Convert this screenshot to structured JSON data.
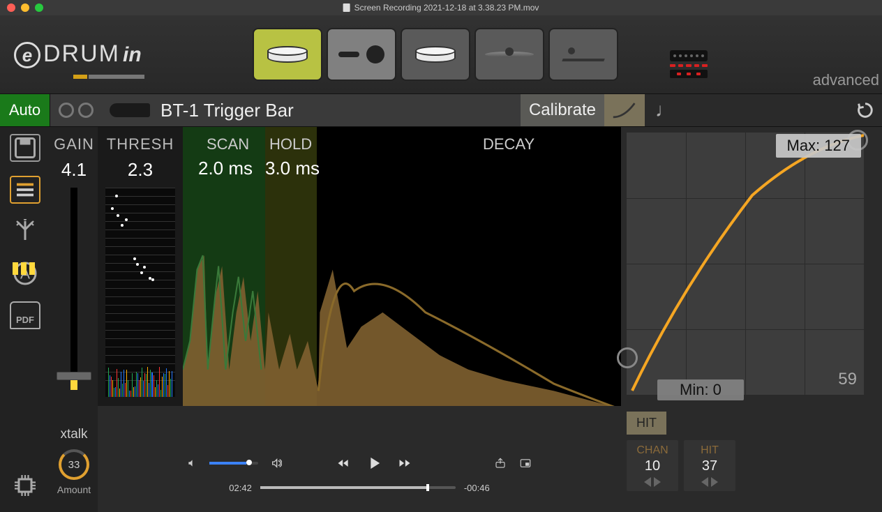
{
  "titlebar": {
    "filename": "Screen Recording 2021-12-18 at 3.38.23 PM.mov"
  },
  "logo": {
    "brand_drum": "DRUM",
    "brand_in": "in"
  },
  "header": {
    "advanced": "advanced"
  },
  "auto_label": "Auto",
  "trigger": {
    "name": "BT-1 Trigger Bar"
  },
  "calibrate": "Calibrate",
  "params": {
    "gain": {
      "label": "GAIN",
      "value": "4.1"
    },
    "thresh": {
      "label": "THRESH",
      "value": "2.3"
    },
    "scan": {
      "label": "SCAN",
      "value": "2.0 ms"
    },
    "hold": {
      "label": "HOLD",
      "value": "3.0 ms"
    },
    "decay": {
      "label": "DECAY"
    }
  },
  "axis_ticks": [
    "0",
    "1",
    "2",
    "3",
    "5",
    "10",
    "20",
    "30",
    "50",
    "100",
    "200"
  ],
  "curve": {
    "max": "Max: 127",
    "min": "Min: 0",
    "value": "59"
  },
  "xtalk": {
    "label": "xtalk",
    "value": "33",
    "unit": "Amount"
  },
  "transport": {
    "elapsed": "02:42",
    "remaining": "-00:46"
  },
  "hit": {
    "tab": "HIT",
    "chan": {
      "label": "CHAN",
      "value": "10"
    },
    "hitnum": {
      "label": "HIT",
      "value": "37"
    }
  },
  "pdf_label": "PDF"
}
